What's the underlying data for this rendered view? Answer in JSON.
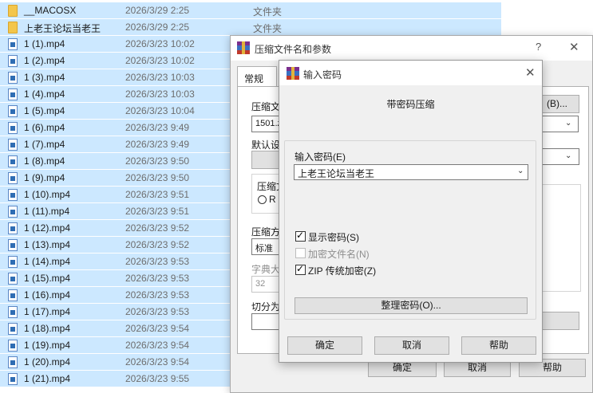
{
  "explorer": {
    "rows": [
      {
        "name": "__MACOSX",
        "date": "2026/3/29 2:25",
        "type": "文件夹",
        "icon": "folder-icon"
      },
      {
        "name": "上老王论坛当老王",
        "date": "2026/3/29 2:25",
        "type": "文件夹",
        "icon": "folder-icon"
      },
      {
        "name": "1 (1).mp4",
        "date": "2026/3/23 10:02",
        "type": "",
        "icon": "video-file-icon"
      },
      {
        "name": "1 (2).mp4",
        "date": "2026/3/23 10:02",
        "type": "",
        "icon": "video-file-icon"
      },
      {
        "name": "1 (3).mp4",
        "date": "2026/3/23 10:03",
        "type": "",
        "icon": "video-file-icon"
      },
      {
        "name": "1 (4).mp4",
        "date": "2026/3/23 10:03",
        "type": "",
        "icon": "video-file-icon"
      },
      {
        "name": "1 (5).mp4",
        "date": "2026/3/23 10:04",
        "type": "",
        "icon": "video-file-icon"
      },
      {
        "name": "1 (6).mp4",
        "date": "2026/3/23 9:49",
        "type": "",
        "icon": "video-file-icon"
      },
      {
        "name": "1 (7).mp4",
        "date": "2026/3/23 9:49",
        "type": "",
        "icon": "video-file-icon"
      },
      {
        "name": "1 (8).mp4",
        "date": "2026/3/23 9:50",
        "type": "",
        "icon": "video-file-icon"
      },
      {
        "name": "1 (9).mp4",
        "date": "2026/3/23 9:50",
        "type": "",
        "icon": "video-file-icon"
      },
      {
        "name": "1 (10).mp4",
        "date": "2026/3/23 9:51",
        "type": "",
        "icon": "video-file-icon"
      },
      {
        "name": "1 (11).mp4",
        "date": "2026/3/23 9:51",
        "type": "",
        "icon": "video-file-icon"
      },
      {
        "name": "1 (12).mp4",
        "date": "2026/3/23 9:52",
        "type": "",
        "icon": "video-file-icon"
      },
      {
        "name": "1 (13).mp4",
        "date": "2026/3/23 9:52",
        "type": "",
        "icon": "video-file-icon"
      },
      {
        "name": "1 (14).mp4",
        "date": "2026/3/23 9:53",
        "type": "",
        "icon": "video-file-icon"
      },
      {
        "name": "1 (15).mp4",
        "date": "2026/3/23 9:53",
        "type": "",
        "icon": "video-file-icon"
      },
      {
        "name": "1 (16).mp4",
        "date": "2026/3/23 9:53",
        "type": "",
        "icon": "video-file-icon"
      },
      {
        "name": "1 (17).mp4",
        "date": "2026/3/23 9:53",
        "type": "",
        "icon": "video-file-icon"
      },
      {
        "name": "1 (18).mp4",
        "date": "2026/3/23 9:54",
        "type": "",
        "icon": "video-file-icon"
      },
      {
        "name": "1 (19).mp4",
        "date": "2026/3/23 9:54",
        "type": "",
        "icon": "video-file-icon"
      },
      {
        "name": "1 (20).mp4",
        "date": "2026/3/23 9:54",
        "type": "",
        "icon": "video-file-icon"
      },
      {
        "name": "1 (21).mp4",
        "date": "2026/3/23 9:55",
        "type": "",
        "icon": "video-file-icon"
      }
    ],
    "selection_color": "#cce8ff"
  },
  "archive_dialog": {
    "title": "压缩文件名和参数",
    "help_glyph": "?",
    "close_glyph": "✕",
    "tab_general": "常规",
    "archive_name_label": "压缩文",
    "browse_button": "(B)...",
    "archive_name_value": "1501.z",
    "default_profile_label": "默认设",
    "archive_format_label": "压缩文",
    "format_radio_label": "R",
    "compression_method_label": "压缩方",
    "compression_method_value": "标准",
    "dictionary_label": "字典大",
    "dictionary_value": "32",
    "split_label": "切分为",
    "ok_button": "确定",
    "cancel_button": "取消",
    "help_button": "帮助"
  },
  "password_dialog": {
    "title": "输入密码",
    "close_glyph": "✕",
    "heading": "带密码压缩",
    "password_label": "输入密码(E)",
    "password_value": "上老王论坛当老王",
    "show_password_label": "显示密码(S)",
    "show_password_checked": true,
    "encrypt_names_label": "加密文件名(N)",
    "encrypt_names_checked": false,
    "zip_legacy_label": "ZIP 传统加密(Z)",
    "zip_legacy_checked": true,
    "organize_button": "整理密码(O)...",
    "ok_button": "确定",
    "cancel_button": "取消",
    "help_button": "帮助"
  }
}
